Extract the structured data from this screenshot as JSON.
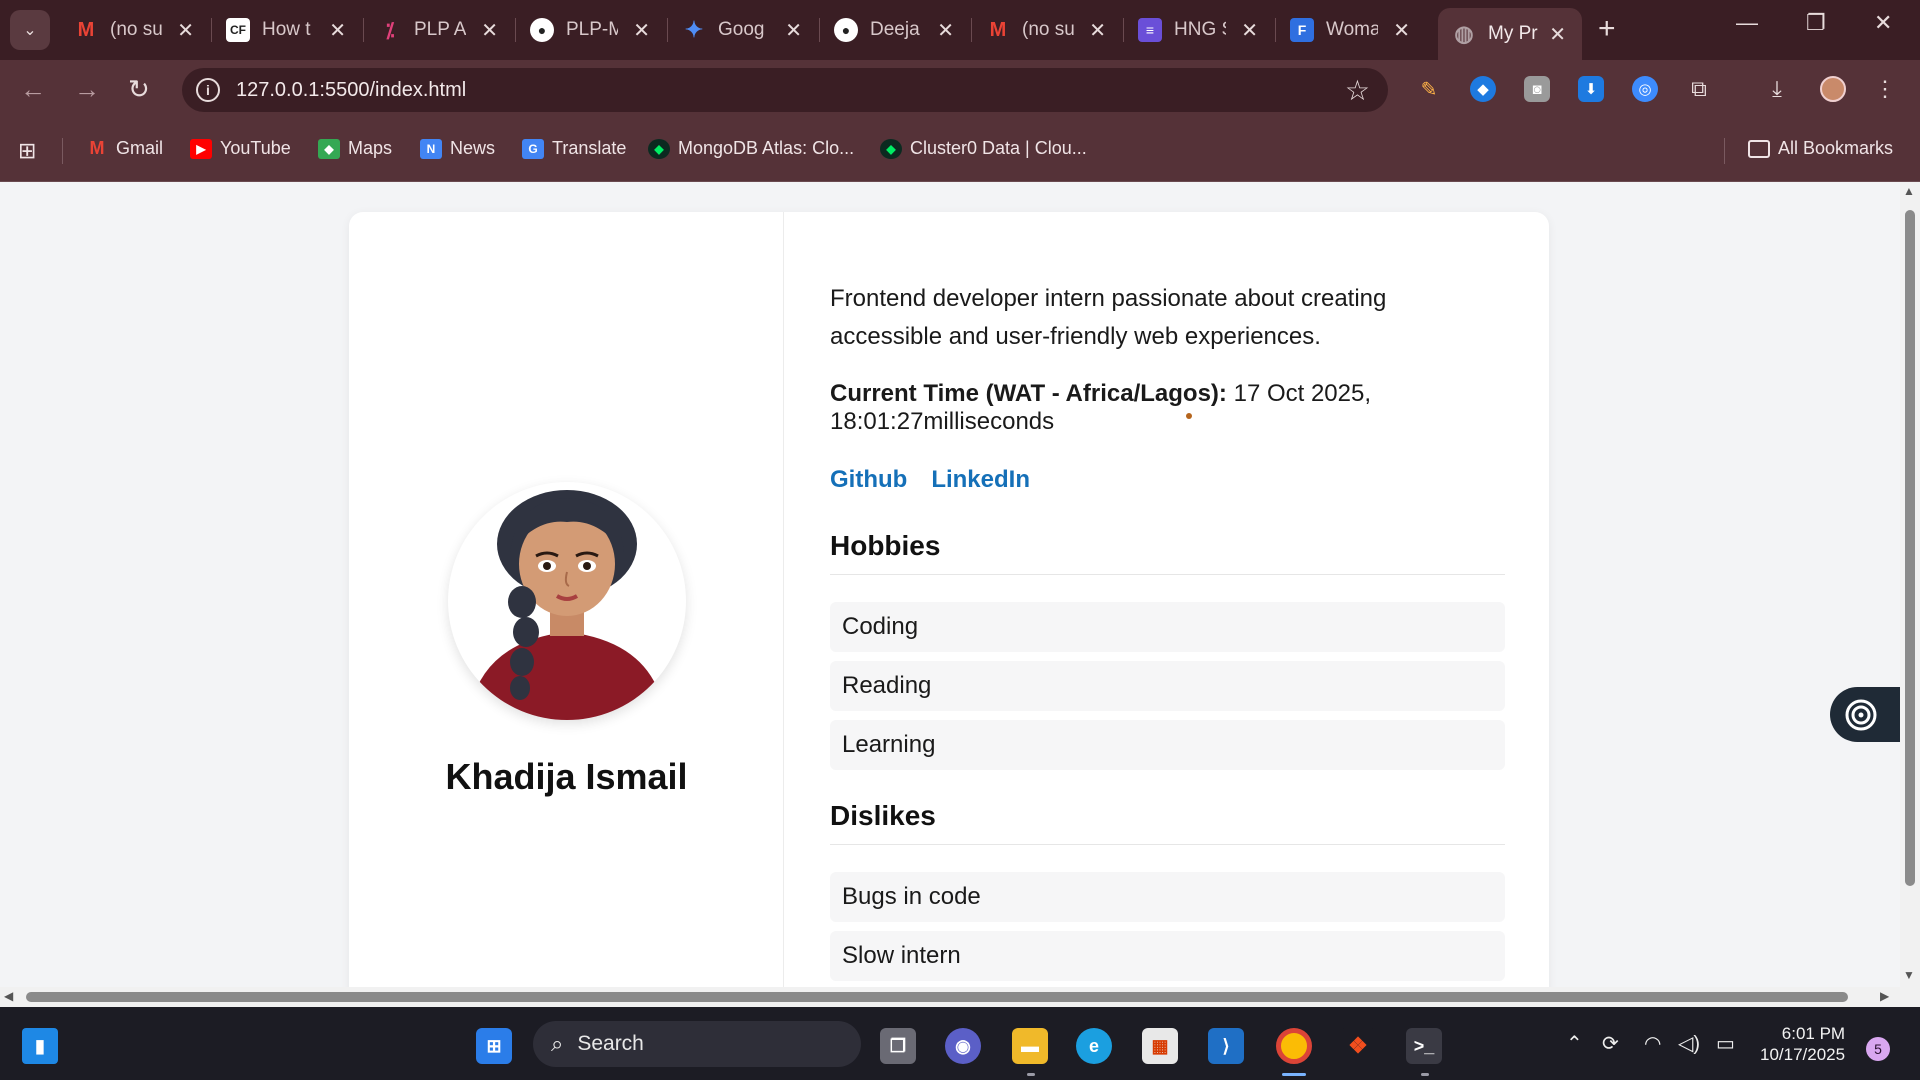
{
  "tabs": [
    {
      "label": "(no su",
      "icon": "gmail-icon",
      "color": "#ea4335",
      "glyph": "M"
    },
    {
      "label": "How t",
      "icon": "cf-icon",
      "color": "#ffffff",
      "glyph": "CF"
    },
    {
      "label": "PLP A",
      "icon": "plp-icon",
      "color": "#c2185b",
      "glyph": "P"
    },
    {
      "label": "PLP-M",
      "icon": "github-icon",
      "color": "#ffffff",
      "glyph": "●"
    },
    {
      "label": "Goog",
      "icon": "gemini-icon",
      "color": "#4f8df5",
      "glyph": "✦"
    },
    {
      "label": "Deeja",
      "icon": "github-icon",
      "color": "#ffffff",
      "glyph": "●"
    },
    {
      "label": "(no su",
      "icon": "gmail-icon",
      "color": "#ea4335",
      "glyph": "M"
    },
    {
      "label": "HNG S",
      "icon": "list-icon",
      "color": "#6a4fd8",
      "glyph": "≡"
    },
    {
      "label": "Woma",
      "icon": "forms-icon",
      "color": "#2f6fe0",
      "glyph": "F"
    },
    {
      "label": "My Pr",
      "icon": "globe-icon",
      "color": "#b0a0a4",
      "glyph": "◍"
    }
  ],
  "address": {
    "url": "127.0.0.1:5500/index.html"
  },
  "bookmarks": [
    {
      "label": "Gmail",
      "icon": "gmail-icon",
      "color": "#ea4335",
      "glyph": "M"
    },
    {
      "label": "YouTube",
      "icon": "youtube-icon",
      "color": "#ff0000",
      "glyph": "▶"
    },
    {
      "label": "Maps",
      "icon": "maps-icon",
      "color": "#34a853",
      "glyph": "◆"
    },
    {
      "label": "News",
      "icon": "news-icon",
      "color": "#4285f4",
      "glyph": "N"
    },
    {
      "label": "Translate",
      "icon": "translate-icon",
      "color": "#4285f4",
      "glyph": "G"
    },
    {
      "label": "MongoDB Atlas: Clo...",
      "icon": "mongodb-icon",
      "color": "#00684a",
      "glyph": "◆"
    },
    {
      "label": "Cluster0 Data | Clou...",
      "icon": "mongodb-icon",
      "color": "#00684a",
      "glyph": "◆"
    }
  ],
  "all_bookmarks": "All Bookmarks",
  "profile": {
    "name": "Khadija Ismail",
    "bio": "Frontend developer intern passionate about creating accessible and user-friendly web experiences.",
    "time_label": "Current Time (WAT - Africa/Lagos):",
    "time_value": "17 Oct 2025, 18:01:27milliseconds",
    "links": [
      {
        "label": "Github"
      },
      {
        "label": "LinkedIn"
      }
    ],
    "hobbies_title": "Hobbies",
    "hobbies": [
      "Coding",
      "Reading",
      "Learning"
    ],
    "dislikes_title": "Dislikes",
    "dislikes": [
      "Bugs in code",
      "Slow intern"
    ]
  },
  "taskbar": {
    "search_label": "Search",
    "time": "6:01 PM",
    "date": "10/17/2025",
    "notifications": "5"
  },
  "colors": {
    "accent_link": "#1570b8",
    "chrome_bg": "#553238"
  }
}
